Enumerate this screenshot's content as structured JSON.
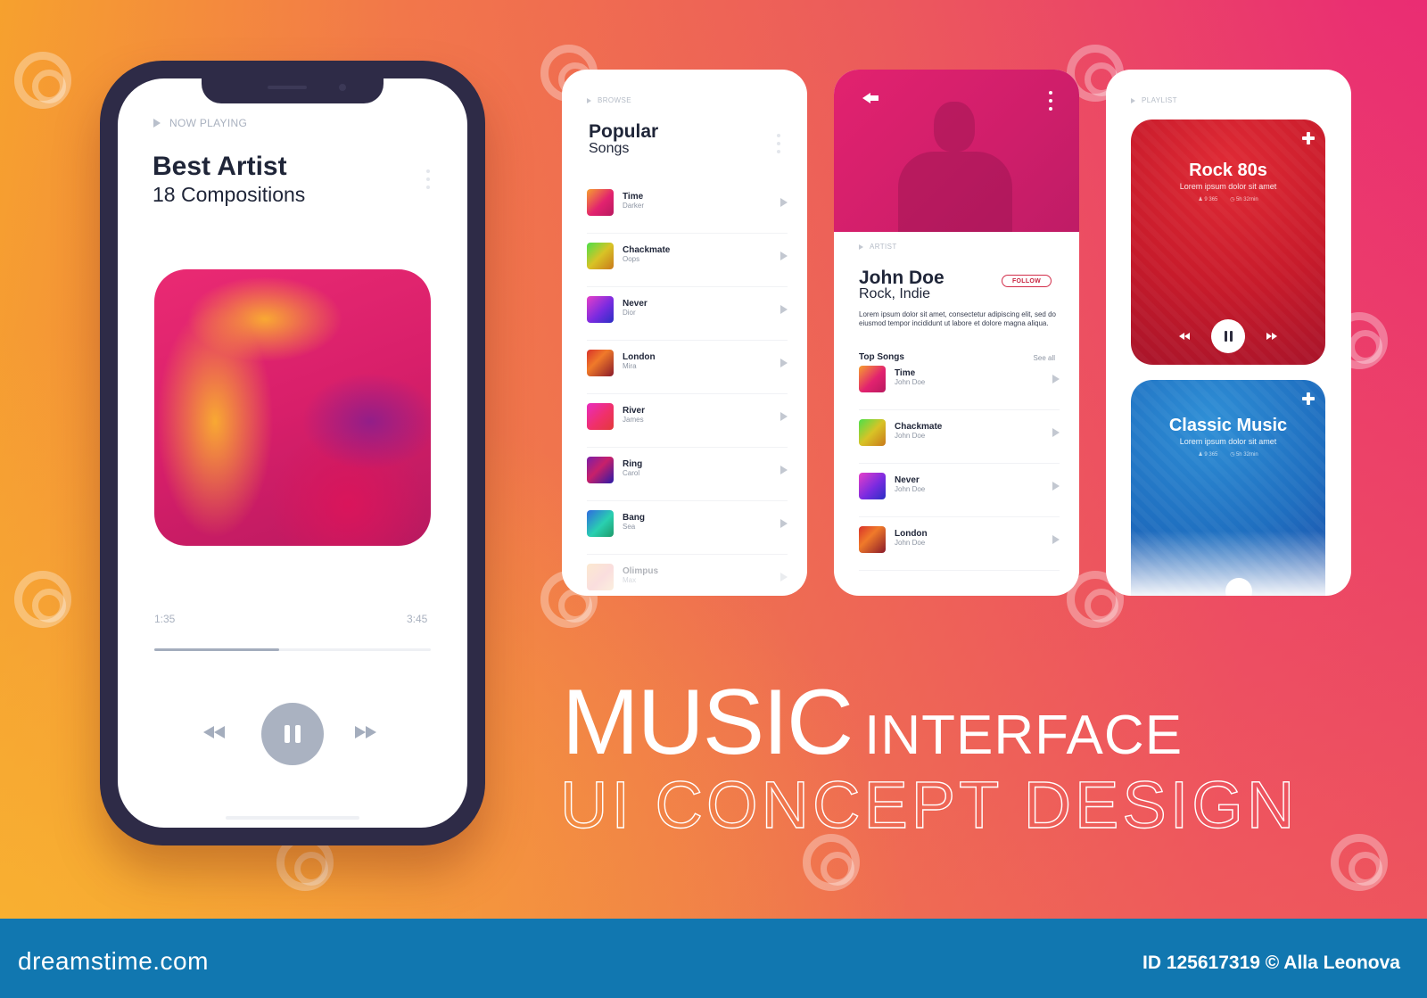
{
  "colors": {
    "accent_pink": "#e92675",
    "accent_orange": "#f6a12e",
    "phone_frame": "#2e2b47",
    "footer_blue": "#1177b0",
    "follow_red": "#c8233f"
  },
  "now_playing": {
    "label": "NOW PLAYING",
    "title": "Best Artist",
    "subtitle": "18 Compositions",
    "elapsed": "1:35",
    "duration": "3:45",
    "progress_percent": 45,
    "icons": {
      "rewind": "rewind-icon",
      "pause": "pause-icon",
      "forward": "fast-forward-icon",
      "more": "more-vertical-icon"
    }
  },
  "browse": {
    "label": "BROWSE",
    "title": "Popular",
    "subtitle": "Songs",
    "songs": [
      {
        "name": "Time",
        "artist": "Darker"
      },
      {
        "name": "Chackmate",
        "artist": "Oops"
      },
      {
        "name": "Never",
        "artist": "Dior"
      },
      {
        "name": "London",
        "artist": "Mira"
      },
      {
        "name": "River",
        "artist": "James"
      },
      {
        "name": "Ring",
        "artist": "Carol"
      },
      {
        "name": "Bang",
        "artist": "Sea"
      },
      {
        "name": "Olimpus",
        "artist": "Max"
      }
    ]
  },
  "artist": {
    "label": "ARTIST",
    "name": "John Doe",
    "genre": "Rock, Indie",
    "follow_label": "FOLLOW",
    "bio": "Lorem ipsum dolor sit amet, consectetur adipiscing elit, sed do eiusmod tempor incididunt ut labore et dolore magna aliqua.",
    "top_songs_label": "Top Songs",
    "see_all_label": "See all",
    "top_songs": [
      {
        "name": "Time",
        "artist": "John Doe"
      },
      {
        "name": "Chackmate",
        "artist": "John Doe"
      },
      {
        "name": "Never",
        "artist": "John Doe"
      },
      {
        "name": "London",
        "artist": "John Doe"
      }
    ]
  },
  "playlist": {
    "label": "PLAYLIST",
    "items": [
      {
        "title": "Rock 80s",
        "subtitle": "Lorem ipsum dolor sit amet",
        "listeners": "9 365",
        "length": "5h 32min"
      },
      {
        "title": "Classic Music",
        "subtitle": "Lorem ipsum dolor sit amet",
        "listeners": "9 365",
        "length": "5h 32min"
      }
    ]
  },
  "heading": {
    "line1_big": "MUSIC",
    "line1_small": "INTERFACE",
    "line2": "UI CONCEPT DESIGN"
  },
  "footer": {
    "logo": "dreamstime.com",
    "credit": "ID 125617319 © Alla Leonova"
  }
}
